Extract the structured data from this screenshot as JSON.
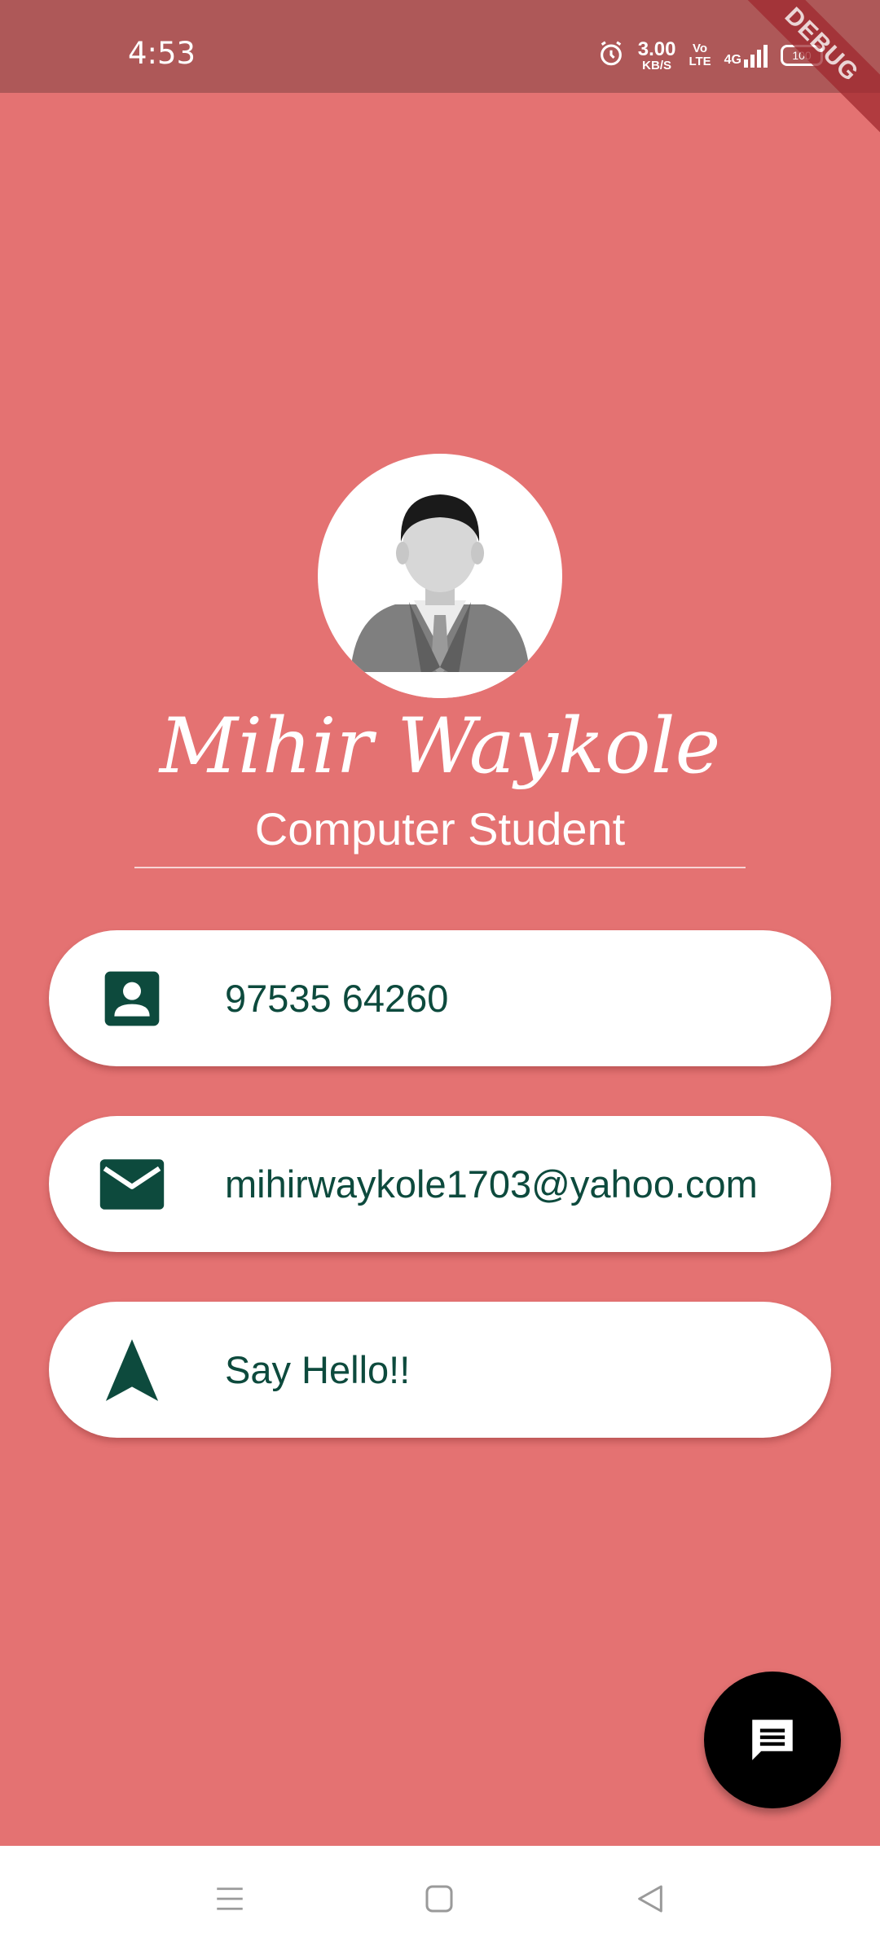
{
  "status_bar": {
    "time": "4:53",
    "speed_value": "3.00",
    "speed_unit": "KB/S",
    "volte_top": "Vo",
    "volte_bottom": "LTE",
    "network": "4G",
    "battery": "100",
    "debug_label": "DEBUG"
  },
  "profile": {
    "name": "Mihir Waykole",
    "subtitle": "Computer Student"
  },
  "contacts": {
    "phone": "97535 64260",
    "email": "mihirwaykole1703@yahoo.com",
    "hello": "Say Hello!!"
  },
  "icons": {
    "phone": "contact-card-icon",
    "email": "mail-icon",
    "hello": "navigation-arrow-icon",
    "fab": "message-icon"
  },
  "colors": {
    "background": "#E47272",
    "status_bar": "#AE5858",
    "accent": "#0D4A3D",
    "card": "#FFFFFF",
    "fab": "#000000"
  }
}
